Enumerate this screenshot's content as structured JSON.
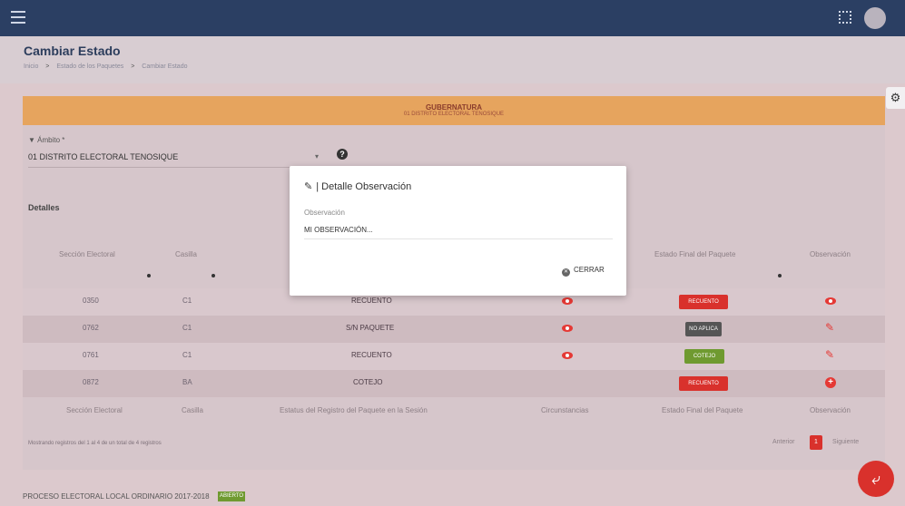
{
  "header": {
    "title": "Cambiar Estado",
    "breadcrumb": [
      "Inicio",
      "Estado de los Paquetes",
      "Cambiar Estado"
    ]
  },
  "banner": {
    "title": "GUBERNATURA",
    "subtitle": "01 DISTRITO ELECTORAL TENOSIQUE"
  },
  "filter": {
    "label": "Ámbito *",
    "value": "01 DISTRITO ELECTORAL TENOSIQUE"
  },
  "details_label": "Detalles",
  "table": {
    "headers": [
      "Sección Electoral",
      "Casilla",
      "Estado Final del Paquete",
      "Observación"
    ],
    "footer_headers": [
      "Sección Electoral",
      "Casilla",
      "Estatus del Registro del Paquete en la Sesión",
      "Circunstancias",
      "Estado Final del Paquete",
      "Observación"
    ],
    "rows": [
      {
        "seccion": "0350",
        "casilla": "C1",
        "estado": "RECUENTO",
        "final": "RECUENTO",
        "final_color": "red"
      },
      {
        "seccion": "0762",
        "casilla": "C1",
        "estado": "S/N PAQUETE",
        "final": "NO APLICA",
        "final_color": "dark"
      },
      {
        "seccion": "0761",
        "casilla": "C1",
        "estado": "RECUENTO",
        "final": "COTEJO",
        "final_color": "green"
      },
      {
        "seccion": "0872",
        "casilla": "BA",
        "estado": "COTEJO",
        "final": "RECUENTO",
        "final_color": "red"
      }
    ],
    "info": "Mostrando registros del 1 al 4 de un total de 4 registros",
    "pagination": {
      "prev": "Anterior",
      "current": "1",
      "next": "Siguiente"
    }
  },
  "footer": {
    "text": "PROCESO ELECTORAL LOCAL ORDINARIO 2017-2018",
    "badge": "ABIERTO"
  },
  "modal": {
    "title": "| Detalle Observación",
    "field_label": "Observación",
    "field_value": "MI OBSERVACIÓN...",
    "close_label": "CERRAR"
  },
  "colors": {
    "topbar": "#2b3f63",
    "banner": "#e6a45e",
    "danger": "#d9312c",
    "success": "#6f9a30"
  }
}
